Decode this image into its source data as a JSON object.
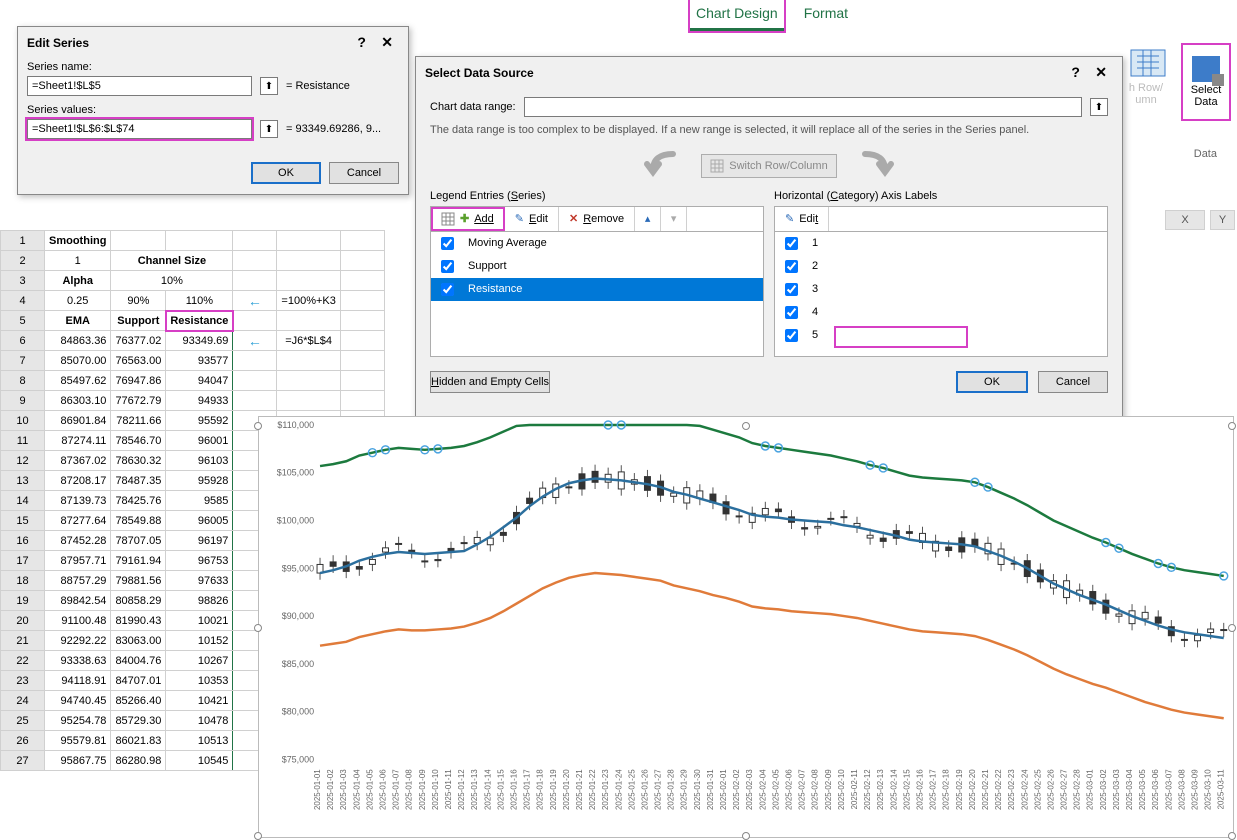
{
  "ribbon": {
    "tabs": [
      "Chart Design",
      "Format"
    ],
    "active": "Chart Design",
    "switchRowCol": "Switch Row/Column",
    "selectData": "Select\nData",
    "groupLabel": "Data",
    "hRowCol": "h Row/\numn"
  },
  "editSeries": {
    "title": "Edit Series",
    "nameLabel": "Series name:",
    "nameValue": "=Sheet1!$L$5",
    "nameResult": "= Resistance",
    "valuesLabel": "Series values:",
    "valuesValue": "=Sheet1!$L$6:$L$74",
    "valuesResult": "= 93349.69286, 9...",
    "ok": "OK",
    "cancel": "Cancel"
  },
  "selectData": {
    "title": "Select Data Source",
    "rangeLabel": "Chart data range:",
    "rangeValue": "",
    "note": "The data range is too complex to be displayed. If a new range is selected, it will replace all of the series in the Series panel.",
    "switch": "Switch Row/Column",
    "legendHdr": "Legend Entries (Series)",
    "axisHdr": "Horizontal (Category) Axis Labels",
    "addBtn": "Add",
    "editBtn": "Edit",
    "removeBtn": "Remove",
    "series": [
      "Moving Average",
      "Support",
      "Resistance"
    ],
    "selectedSeries": "Resistance",
    "categories": [
      "1",
      "2",
      "3",
      "4",
      "5"
    ],
    "hidden": "Hidden and Empty Cells",
    "ok": "OK",
    "cancel": "Cancel"
  },
  "sheet": {
    "cols": [
      "",
      "",
      "",
      "",
      "",
      ""
    ],
    "rows": [
      {
        "r": 1,
        "c": [
          "Smoothing",
          "",
          "",
          "",
          "",
          ""
        ],
        "bold": [
          0
        ]
      },
      {
        "r": 2,
        "c": [
          "1",
          "Channel Size",
          "",
          "",
          "",
          ""
        ],
        "bold": [
          1
        ],
        "span2": 1
      },
      {
        "r": 3,
        "c": [
          "Alpha",
          "10%",
          "",
          "",
          "",
          ""
        ],
        "bold": [
          0
        ],
        "span2": 1
      },
      {
        "r": 4,
        "c": [
          "0.25",
          "90%",
          "110%",
          "←",
          "=100%+K3",
          ""
        ],
        "arrow": 3
      },
      {
        "r": 5,
        "c": [
          "EMA",
          "Support",
          "Resistance",
          "",
          "",
          ""
        ],
        "bold": [
          0,
          1,
          2
        ],
        "resist": 2
      },
      {
        "r": 6,
        "c": [
          "84863.36",
          "76377.02",
          "93349.69",
          "←",
          "=J6*$L$4",
          ""
        ],
        "arrow": 3
      },
      {
        "r": 7,
        "c": [
          "85070.00",
          "76563.00",
          "93577",
          "",
          "",
          ""
        ]
      },
      {
        "r": 8,
        "c": [
          "85497.62",
          "76947.86",
          "94047",
          "",
          "",
          ""
        ]
      },
      {
        "r": 9,
        "c": [
          "86303.10",
          "77672.79",
          "94933",
          "",
          "",
          ""
        ]
      },
      {
        "r": 10,
        "c": [
          "86901.84",
          "78211.66",
          "95592",
          "",
          "",
          ""
        ]
      },
      {
        "r": 11,
        "c": [
          "87274.11",
          "78546.70",
          "96001",
          "",
          "",
          ""
        ]
      },
      {
        "r": 12,
        "c": [
          "87367.02",
          "78630.32",
          "96103",
          "",
          "",
          ""
        ]
      },
      {
        "r": 13,
        "c": [
          "87208.17",
          "78487.35",
          "95928",
          "",
          "",
          ""
        ]
      },
      {
        "r": 14,
        "c": [
          "87139.73",
          "78425.76",
          "9585",
          "",
          "",
          ""
        ]
      },
      {
        "r": 15,
        "c": [
          "87277.64",
          "78549.88",
          "96005",
          "",
          "",
          ""
        ]
      },
      {
        "r": 16,
        "c": [
          "87452.28",
          "78707.05",
          "96197",
          "",
          "",
          ""
        ]
      },
      {
        "r": 17,
        "c": [
          "87957.71",
          "79161.94",
          "96753",
          "",
          "",
          ""
        ]
      },
      {
        "r": 18,
        "c": [
          "88757.29",
          "79881.56",
          "97633",
          "",
          "",
          ""
        ]
      },
      {
        "r": 19,
        "c": [
          "89842.54",
          "80858.29",
          "98826",
          "",
          "",
          ""
        ]
      },
      {
        "r": 20,
        "c": [
          "91100.48",
          "81990.43",
          "10021",
          "",
          "",
          ""
        ]
      },
      {
        "r": 21,
        "c": [
          "92292.22",
          "83063.00",
          "10152",
          "",
          "",
          ""
        ]
      },
      {
        "r": 22,
        "c": [
          "93338.63",
          "84004.76",
          "10267",
          "",
          "",
          ""
        ]
      },
      {
        "r": 23,
        "c": [
          "94118.91",
          "84707.01",
          "10353",
          "",
          "",
          ""
        ]
      },
      {
        "r": 24,
        "c": [
          "94740.45",
          "85266.40",
          "10421",
          "",
          "",
          ""
        ]
      },
      {
        "r": 25,
        "c": [
          "95254.78",
          "85729.30",
          "10478",
          "",
          "",
          ""
        ]
      },
      {
        "r": 26,
        "c": [
          "95579.81",
          "86021.83",
          "10513",
          "",
          "",
          ""
        ]
      },
      {
        "r": 27,
        "c": [
          "95867.75",
          "86280.98",
          "10545",
          "",
          "",
          ""
        ]
      }
    ]
  },
  "chart_data": {
    "type": "line",
    "x_dates": [
      "2025-01-01",
      "2025-01-02",
      "2025-01-03",
      "2025-01-04",
      "2025-01-05",
      "2025-01-06",
      "2025-01-07",
      "2025-01-08",
      "2025-01-09",
      "2025-01-10",
      "2025-01-11",
      "2025-01-12",
      "2025-01-13",
      "2025-01-14",
      "2025-01-15",
      "2025-01-16",
      "2025-01-17",
      "2025-01-18",
      "2025-01-19",
      "2025-01-20",
      "2025-01-21",
      "2025-01-22",
      "2025-01-23",
      "2025-01-24",
      "2025-01-25",
      "2025-01-26",
      "2025-01-27",
      "2025-01-28",
      "2025-01-29",
      "2025-01-30",
      "2025-01-31",
      "2025-02-01",
      "2025-02-02",
      "2025-02-03",
      "2025-02-04",
      "2025-02-05",
      "2025-02-06",
      "2025-02-07",
      "2025-02-08",
      "2025-02-09",
      "2025-02-10",
      "2025-02-11",
      "2025-02-12",
      "2025-02-13",
      "2025-02-14",
      "2025-02-15",
      "2025-02-16",
      "2025-02-17",
      "2025-02-18",
      "2025-02-19",
      "2025-02-20",
      "2025-02-21",
      "2025-02-22",
      "2025-02-23",
      "2025-02-24",
      "2025-02-25",
      "2025-02-26",
      "2025-02-27",
      "2025-02-28",
      "2025-03-01",
      "2025-03-02",
      "2025-03-03",
      "2025-03-04",
      "2025-03-05",
      "2025-03-06",
      "2025-03-07",
      "2025-03-08",
      "2025-03-09",
      "2025-03-10",
      "2025-03-11"
    ],
    "ylim": [
      75000,
      110000
    ],
    "yticks": [
      "$75,000",
      "$80,000",
      "$85,000",
      "$90,000",
      "$95,000",
      "$100,000",
      "$105,000",
      "$110,000"
    ],
    "series": [
      {
        "name": "Moving Average",
        "color": "#2b6f9e",
        "values": [
          94500,
          94800,
          95200,
          95800,
          96200,
          96500,
          96700,
          96600,
          96500,
          96600,
          96700,
          96800,
          97500,
          98300,
          99300,
          100300,
          101500,
          102500,
          103300,
          103900,
          104200,
          104400,
          104300,
          104200,
          104000,
          103800,
          103500,
          103000,
          102700,
          102300,
          101900,
          101500,
          101100,
          100600,
          100400,
          100300,
          100100,
          100000,
          99900,
          99800,
          99500,
          99300,
          99000,
          98700,
          98400,
          98000,
          97800,
          97700,
          97600,
          97500,
          97300,
          96800,
          96300,
          95700,
          95000,
          94200,
          93400,
          92800,
          92200,
          91700,
          91200,
          90600,
          90000,
          89500,
          89000,
          88600,
          88300,
          88100,
          87900,
          87700
        ]
      },
      {
        "name": "Support",
        "color": "#e07b3a",
        "values": [
          86900,
          87100,
          87300,
          87800,
          88100,
          88400,
          88600,
          88500,
          88500,
          88600,
          88700,
          88900,
          89300,
          89800,
          90500,
          91300,
          92100,
          92900,
          93500,
          94000,
          94300,
          94500,
          94400,
          94300,
          94100,
          93900,
          93700,
          93200,
          92900,
          92600,
          92200,
          91900,
          91500,
          91000,
          90800,
          90700,
          90500,
          90400,
          90300,
          90200,
          90000,
          89800,
          89500,
          89200,
          88900,
          88600,
          88400,
          88300,
          88200,
          88100,
          87900,
          87500,
          87000,
          86500,
          85900,
          85200,
          84500,
          83900,
          83400,
          82900,
          82500,
          82000,
          81500,
          81000,
          80600,
          80200,
          79900,
          79700,
          79500,
          79300
        ]
      },
      {
        "name": "Resistance",
        "color": "#1c7a3e",
        "values": [
          105700,
          105900,
          106200,
          106800,
          107100,
          107400,
          107600,
          107500,
          107400,
          107500,
          107600,
          107800,
          108200,
          108700,
          109300,
          109900,
          110000,
          110000,
          110000,
          110000,
          110000,
          110000,
          110000,
          110000,
          110000,
          110000,
          110000,
          110000,
          110000,
          109900,
          109500,
          109100,
          108700,
          108100,
          107800,
          107600,
          107400,
          107200,
          107000,
          106800,
          106500,
          106200,
          105800,
          105500,
          105100,
          104700,
          104500,
          104400,
          104300,
          104200,
          104000,
          103500,
          102900,
          102300,
          101600,
          100800,
          100000,
          99400,
          98800,
          98200,
          97700,
          97100,
          96500,
          96000,
          95500,
          95100,
          94800,
          94600,
          94400,
          94200
        ]
      }
    ],
    "candles_note": "OHLC candlesticks underlay the three line series; individual candle values not labeled on chart."
  }
}
